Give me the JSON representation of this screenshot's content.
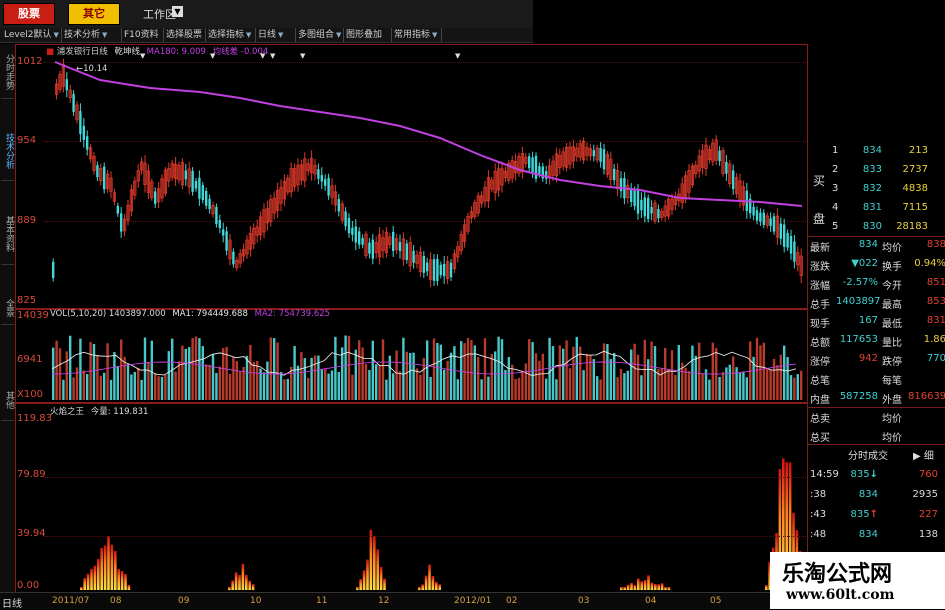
{
  "topbar": {
    "tab_stock": "股票",
    "tab_other": "其它",
    "workspace": "工作区"
  },
  "toolbar": [
    {
      "label": "Level2默认",
      "dd": true
    },
    {
      "label": "技术分析",
      "dd": true
    },
    {
      "label": "F10资料",
      "dd": false
    },
    {
      "label": "选择股票",
      "dd": false
    },
    {
      "label": "选择指标",
      "dd": true
    },
    {
      "label": "日线",
      "dd": true
    },
    {
      "label": "多图组合",
      "dd": true
    },
    {
      "label": "图形叠加",
      "dd": false
    },
    {
      "label": "常用指标",
      "dd": true
    }
  ],
  "side_tabs": [
    "分时走势",
    "技术分析",
    "基本资料",
    "全景",
    "其他"
  ],
  "price_panel": {
    "stock_name": "浦发银行日线",
    "indicator": "乾坤线",
    "ma_label": "MA180: 9.009",
    "trend_label": "均线差",
    "trend_value": "-0.004",
    "high_marker": "10.14",
    "y_ticks": [
      "1012",
      "954",
      "889",
      "825"
    ]
  },
  "volume_panel": {
    "legend_name": "VOL(5,10,20)",
    "legend_value": "1403897.000",
    "ma1": "MA1: 794449.688",
    "ma2": "MA2: 754739.625",
    "y_ticks": [
      "14039",
      "6941",
      "X100"
    ]
  },
  "indicator_panel": {
    "name": "火焰之王",
    "value_label": "今量: 119.831",
    "y_ticks": [
      "119.83",
      "79.89",
      "39.94",
      "0.00"
    ]
  },
  "order_book": {
    "buy_label": "买",
    "sell_label": "盘",
    "rows": [
      {
        "lvl": "1",
        "price": "834",
        "vol": "213"
      },
      {
        "lvl": "2",
        "price": "833",
        "vol": "2737"
      },
      {
        "lvl": "3",
        "price": "832",
        "vol": "4838"
      },
      {
        "lvl": "4",
        "price": "831",
        "vol": "7115"
      },
      {
        "lvl": "5",
        "price": "830",
        "vol": "28183"
      }
    ]
  },
  "quote": [
    {
      "k1": "最新",
      "v1": "834",
      "k2": "均价",
      "v2": "838"
    },
    {
      "k1": "涨跌",
      "v1": "▼022",
      "k2": "换手",
      "v2": "0.94%"
    },
    {
      "k1": "涨幅",
      "v1": "-2.57%",
      "k2": "今开",
      "v2": "851"
    },
    {
      "k1": "总手",
      "v1": "1403897",
      "k2": "最高",
      "v2": "853"
    },
    {
      "k1": "现手",
      "v1": "167",
      "k2": "最低",
      "v2": "831"
    },
    {
      "k1": "总额",
      "v1": "117653",
      "k2": "量比",
      "v2": "1.86"
    },
    {
      "k1": "涨停",
      "v1": "942",
      "k2": "跌停",
      "v2": "770"
    },
    {
      "k1": "总笔",
      "v1": "",
      "k2": "每笔",
      "v2": ""
    },
    {
      "k1": "内盘",
      "v1": "587258",
      "k2": "外盘",
      "v2": "816639"
    },
    {
      "k1": "总卖",
      "v1": "",
      "k2": "均价",
      "v2": ""
    },
    {
      "k1": "总买",
      "v1": "",
      "k2": "均价",
      "v2": ""
    }
  ],
  "trades": {
    "title": "分时成交",
    "btn": "细",
    "rows": [
      {
        "time": "14:59",
        "price": "835",
        "vol": "760",
        "dir": "↓"
      },
      {
        "time": ":38",
        "price": "834",
        "vol": "2935",
        "dir": ""
      },
      {
        "time": ":43",
        "price": "835",
        "vol": "227",
        "dir": "↑"
      },
      {
        "time": ":48",
        "price": "834",
        "vol": "138",
        "dir": ""
      }
    ]
  },
  "footer": {
    "label": "日线",
    "dates": [
      "2011/07",
      "08",
      "09",
      "10",
      "11",
      "12",
      "2012/01",
      "02",
      "03",
      "04",
      "05"
    ]
  },
  "watermark": {
    "title": "乐淘公式网",
    "url": "www.60lt.com"
  },
  "colors": {
    "up": "#e03a2a",
    "down": "#40d8d8",
    "ma_line": "#c040e0",
    "grid": "#7a1414",
    "label": "#d84a3a"
  }
}
